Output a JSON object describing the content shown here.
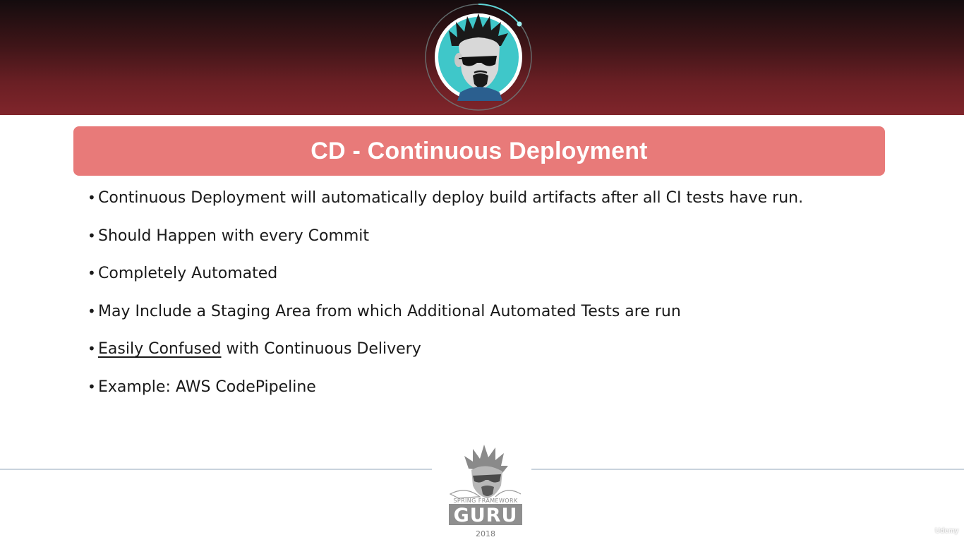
{
  "slide": {
    "title": "CD - Continuous Deployment",
    "bullets": [
      {
        "text": "Continuous Deployment will automatically deploy build artifacts after all CI tests have run."
      },
      {
        "text": "Should Happen with every Commit"
      },
      {
        "text": "Completely Automated"
      },
      {
        "text": "May Include a Staging Area from which Additional Automated Tests are run"
      },
      {
        "underlined": "Easily Confused",
        "text": " with Continuous Delivery"
      },
      {
        "text": "Example: AWS CodePipeline"
      }
    ],
    "bullet_glyph": "•"
  },
  "logo": {
    "line1": "SPRING FRAMEWORK",
    "line2": "GURU",
    "year": "2018"
  },
  "watermark": {
    "text": "Udemy"
  },
  "icons": {
    "header_avatar": "guru-avatar-icon",
    "footer_logo": "spring-framework-guru-logo",
    "watermark": "udemy-logo-icon"
  },
  "colors": {
    "header_dark": "#140c0e",
    "header_red": "#80252b",
    "title_bar": "#e87a79",
    "avatar_ring": "#3fc7c9",
    "footer_line": "#c9d3dd"
  }
}
